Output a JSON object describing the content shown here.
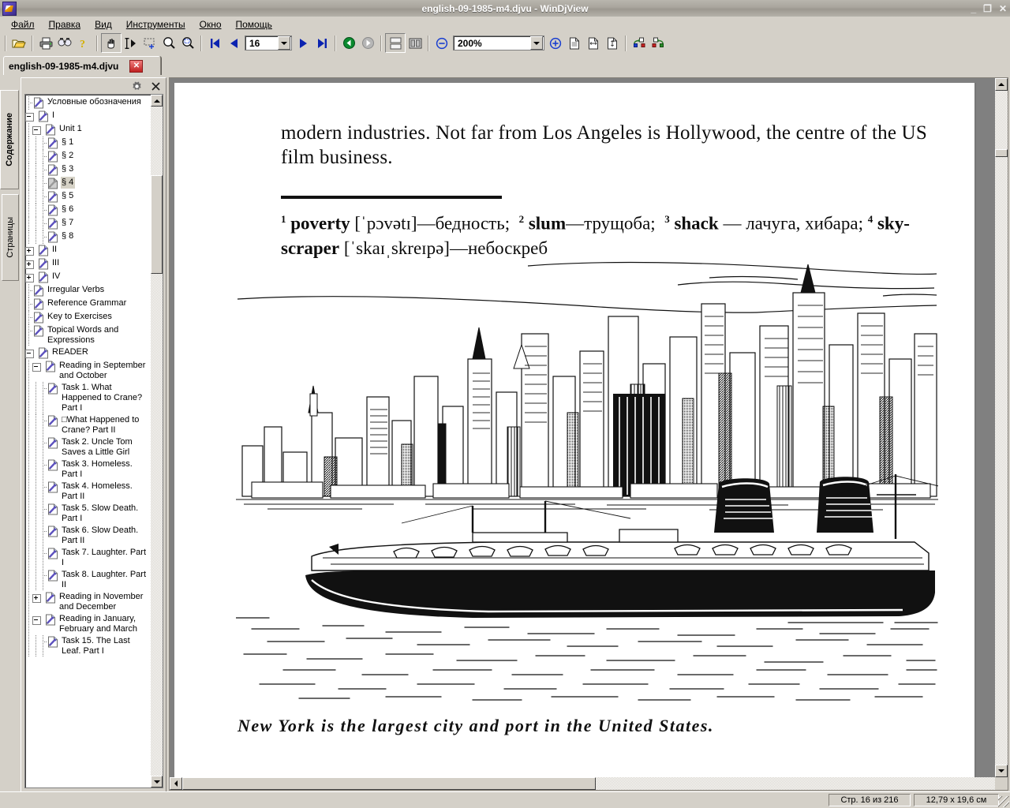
{
  "window": {
    "title": "english-09-1985-m4.djvu - WinDjView",
    "minimize_label": "_",
    "restore_label": "❐",
    "close_label": "✕"
  },
  "menubar": {
    "items": [
      {
        "label": "Файл",
        "mnemonic": "Ф"
      },
      {
        "label": "Правка",
        "mnemonic": "П"
      },
      {
        "label": "Вид",
        "mnemonic": "В"
      },
      {
        "label": "Инструменты",
        "mnemonic": "И"
      },
      {
        "label": "Окно",
        "mnemonic": "О"
      },
      {
        "label": "Помощь",
        "mnemonic": "м"
      }
    ]
  },
  "toolbar": {
    "open_label": "open-folder",
    "print_label": "print",
    "find_label": "find",
    "about_label": "about",
    "hand_label": "hand-tool",
    "select_text_label": "text-select-tool",
    "rect_select_label": "rect-select-tool",
    "zoom_in_tool_label": "magnifier-tool",
    "zoom_rect_label": "magnifier-rect-tool",
    "first_page_label": "first-page",
    "prev_page_label": "previous-page",
    "page_value": "16",
    "next_page_label": "next-page",
    "last_page_label": "last-page",
    "back_label": "go-back",
    "forward_label": "go-forward",
    "layout_single_label": "continuous-layout",
    "layout_facing_label": "facing-layout",
    "zoom_out_label": "zoom-out",
    "zoom_value": "200%",
    "zoom_in_label": "zoom-in",
    "fit_page_label": "fit-page",
    "fit_width_label": "fit-width",
    "fit_actual_label": "actual-size",
    "rotate_left_label": "rotate-left",
    "rotate_right_label": "rotate-right"
  },
  "doctab": {
    "label": "english-09-1985-m4.djvu",
    "close_label": "✕"
  },
  "sidetabs": {
    "contents": "Содержание",
    "pages": "Страницы"
  },
  "navpanel": {
    "settings_icon": "gear-icon",
    "close_icon": "close-icon",
    "tree": [
      {
        "depth": 0,
        "label": "Условные обозначения",
        "expander": "none",
        "selected": false
      },
      {
        "depth": 0,
        "label": "I",
        "expander": "minus",
        "selected": false
      },
      {
        "depth": 1,
        "label": "Unit 1",
        "expander": "minus",
        "selected": false
      },
      {
        "depth": 2,
        "label": "§ 1",
        "expander": "none",
        "selected": false
      },
      {
        "depth": 2,
        "label": "§ 2",
        "expander": "none",
        "selected": false
      },
      {
        "depth": 2,
        "label": "§ 3",
        "expander": "none",
        "selected": false
      },
      {
        "depth": 2,
        "label": "§ 4",
        "expander": "none",
        "selected": true
      },
      {
        "depth": 2,
        "label": "§ 5",
        "expander": "none",
        "selected": false
      },
      {
        "depth": 2,
        "label": "§ 6",
        "expander": "none",
        "selected": false
      },
      {
        "depth": 2,
        "label": "§ 7",
        "expander": "none",
        "selected": false
      },
      {
        "depth": 2,
        "label": "§ 8",
        "expander": "none",
        "selected": false
      },
      {
        "depth": 0,
        "label": "II",
        "expander": "plus",
        "selected": false
      },
      {
        "depth": 0,
        "label": "III",
        "expander": "plus",
        "selected": false
      },
      {
        "depth": 0,
        "label": "IV",
        "expander": "plus",
        "selected": false
      },
      {
        "depth": 0,
        "label": "Irregular Verbs",
        "expander": "none",
        "selected": false
      },
      {
        "depth": 0,
        "label": "Reference Grammar",
        "expander": "none",
        "selected": false
      },
      {
        "depth": 0,
        "label": "Key to Exercises",
        "expander": "none",
        "selected": false
      },
      {
        "depth": 0,
        "label": "Topical Words and Expressions",
        "expander": "none",
        "selected": false
      },
      {
        "depth": 0,
        "label": "READER",
        "expander": "minus",
        "selected": false
      },
      {
        "depth": 1,
        "label": "Reading in September and October",
        "expander": "minus",
        "selected": false
      },
      {
        "depth": 2,
        "label": "Task 1. What Happened to Crane? Part I",
        "expander": "none",
        "selected": false
      },
      {
        "depth": 2,
        "label": "□What Happened to Crane? Part II",
        "expander": "none",
        "selected": false
      },
      {
        "depth": 2,
        "label": "Task 2. Uncle Tom Saves a Little Girl",
        "expander": "none",
        "selected": false
      },
      {
        "depth": 2,
        "label": "Task 3. Homeless. Part I",
        "expander": "none",
        "selected": false
      },
      {
        "depth": 2,
        "label": "Task 4. Homeless. Part II",
        "expander": "none",
        "selected": false
      },
      {
        "depth": 2,
        "label": "Task 5. Slow Death. Part I",
        "expander": "none",
        "selected": false
      },
      {
        "depth": 2,
        "label": "Task 6. Slow Death. Part II",
        "expander": "none",
        "selected": false
      },
      {
        "depth": 2,
        "label": "Task 7. Laughter. Part I",
        "expander": "none",
        "selected": false
      },
      {
        "depth": 2,
        "label": "Task 8. Laughter. Part II",
        "expander": "none",
        "selected": false
      },
      {
        "depth": 1,
        "label": "Reading in November and December",
        "expander": "plus",
        "selected": false
      },
      {
        "depth": 1,
        "label": "Reading in January, February and March",
        "expander": "minus",
        "selected": false
      },
      {
        "depth": 2,
        "label": "Task 15. The Last Leaf. Part I",
        "expander": "none",
        "selected": false
      }
    ]
  },
  "document": {
    "body_text": "modern industries. Not far from Los Angeles is Hollywood, the centre of the US film business.",
    "footnotes": {
      "n1_sup": "1",
      "n1_term": "poverty",
      "n1_ipa": "[ˈpɔvətɪ]",
      "n1_sep": "—",
      "n1_translation": "бедность;",
      "n2_sup": "2",
      "n2_term": "slum",
      "n2_sep": "—",
      "n2_translation": "трущоба;",
      "n3_sup": "3",
      "n3_term": "shack",
      "n3_sep": "—",
      "n3_translation": "лачуга, хибара;",
      "n4_sup": "4",
      "n4_term": "sky-scraper",
      "n4_ipa": "[ˈskaɪˌskreɪpə]",
      "n4_sep": "—",
      "n4_translation": "небоскреб"
    },
    "illustration_alt": "Engraving of the New York City skyline with an ocean liner in the harbour",
    "caption": "New York is the largest city and port in the United States."
  },
  "statusbar": {
    "page_indicator": "Стр. 16 из 216",
    "page_size": "12,79 x 19,6 см"
  },
  "colors": {
    "window_face": "#d4d0c8",
    "title_gradient_start": "#b9b6ae",
    "title_gradient_end": "#9c9890",
    "selection": "#d6d2c6",
    "tree_icon_accent": "#6a5acd",
    "close_button": "#c02020"
  }
}
